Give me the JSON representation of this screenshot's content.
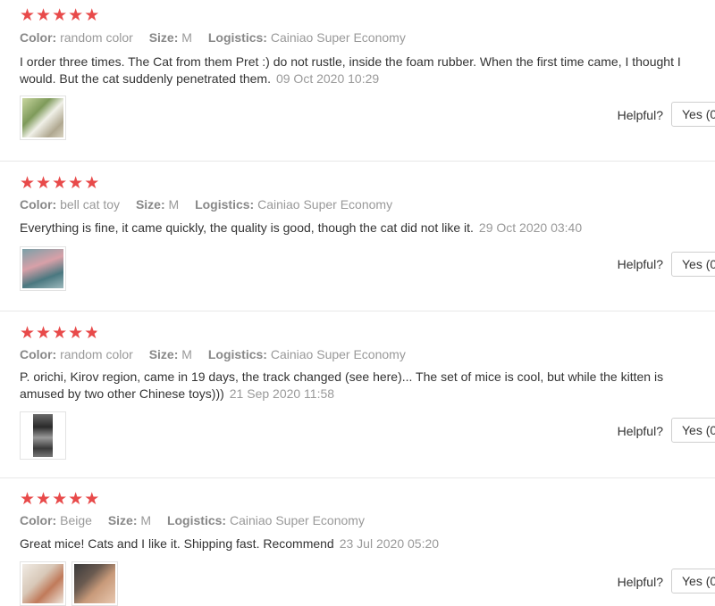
{
  "reviews": [
    {
      "rating": 5,
      "color_label": "Color:",
      "color": "random color",
      "size_label": "Size:",
      "size": "M",
      "logistics_label": "Logistics:",
      "logistics": "Cainiao Super Economy",
      "text": "I order three times. The Cat from them Pret :) do not rustle, inside the foam rubber. When the first time came, I thought I would. But the cat suddenly penetrated them.",
      "date": "09 Oct 2020 10:29",
      "photo_count": 1,
      "helpful_label": "Helpful?",
      "yes_label": "Yes (0"
    },
    {
      "rating": 5,
      "color_label": "Color:",
      "color": "bell cat toy",
      "size_label": "Size:",
      "size": "M",
      "logistics_label": "Logistics:",
      "logistics": "Cainiao Super Economy",
      "text": "Everything is fine, it came quickly, the quality is good, though the cat did not like it.",
      "date": "29 Oct 2020 03:40",
      "photo_count": 1,
      "helpful_label": "Helpful?",
      "yes_label": "Yes (0"
    },
    {
      "rating": 4.8,
      "color_label": "Color:",
      "color": "random color",
      "size_label": "Size:",
      "size": "M",
      "logistics_label": "Logistics:",
      "logistics": "Cainiao Super Economy",
      "text": "P. orichi, Kirov region, came in 19 days, the track changed (see here)... The set of mice is cool, but while the kitten is amused by two other Chinese toys)))",
      "date": "21 Sep 2020 11:58",
      "photo_count": 1,
      "helpful_label": "Helpful?",
      "yes_label": "Yes (0"
    },
    {
      "rating": 5,
      "color_label": "Color:",
      "color": "Beige",
      "size_label": "Size:",
      "size": "M",
      "logistics_label": "Logistics:",
      "logistics": "Cainiao Super Economy",
      "text": "Great mice! Cats and I like it. Shipping fast. Recommend",
      "date": "23 Jul 2020 05:20",
      "photo_count": 2,
      "helpful_label": "Helpful?",
      "yes_label": "Yes (0"
    }
  ],
  "colors": {
    "star": "#e84a4a",
    "muted": "#999999"
  },
  "icons": {
    "star": "star-icon"
  }
}
